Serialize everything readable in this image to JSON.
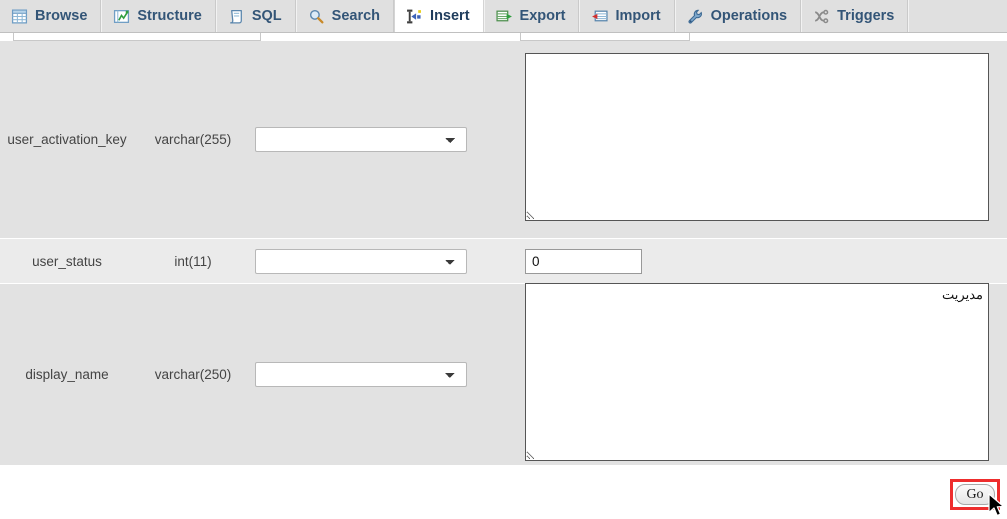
{
  "tabs": [
    {
      "label": "Browse",
      "icon": "browse-grid-icon",
      "active": false
    },
    {
      "label": "Structure",
      "icon": "structure-icon",
      "active": false
    },
    {
      "label": "SQL",
      "icon": "sql-scroll-icon",
      "active": false
    },
    {
      "label": "Search",
      "icon": "search-magnifier-icon",
      "active": false
    },
    {
      "label": "Insert",
      "icon": "insert-row-icon",
      "active": true
    },
    {
      "label": "Export",
      "icon": "export-icon",
      "active": false
    },
    {
      "label": "Import",
      "icon": "import-icon",
      "active": false
    },
    {
      "label": "Operations",
      "icon": "wrench-icon",
      "active": false
    },
    {
      "label": "Triggers",
      "icon": "triggers-icon",
      "active": false
    }
  ],
  "form": {
    "rows": [
      {
        "column": "user_activation_key",
        "type": "varchar(255)",
        "function": "",
        "value": "",
        "control": "textarea"
      },
      {
        "column": "user_status",
        "type": "int(11)",
        "function": "",
        "value": "0",
        "control": "input"
      },
      {
        "column": "display_name",
        "type": "varchar(250)",
        "function": "",
        "value": "مدیریت",
        "control": "textarea"
      }
    ],
    "function_placeholder": ""
  },
  "submit": {
    "go_label": "Go",
    "highlight_color": "#ee2d2d"
  },
  "colors": {
    "tab_active_bg": "#ffffff",
    "tab_inactive_bg": "#e0e0e0",
    "tab_text": "#335577",
    "row_odd_bg": "#e2e2e2",
    "row_even_bg": "#ebebeb",
    "page_bg": "#ffffff"
  }
}
